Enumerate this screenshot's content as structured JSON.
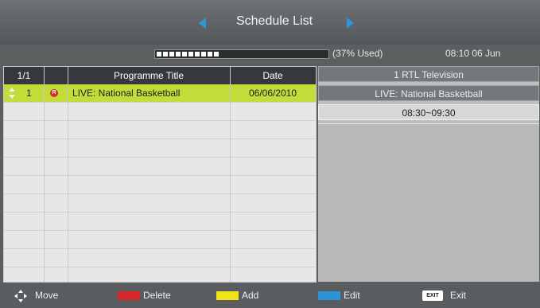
{
  "header": {
    "title": "Schedule List",
    "usage_text": "(37% Used)",
    "usage_fraction": 0.37,
    "clock": "08:10  06 Jun"
  },
  "table": {
    "page": "1/1",
    "columns": [
      "Programme Title",
      "Date"
    ],
    "rows": [
      {
        "index": "1",
        "title": "LIVE: National Basketball",
        "date": "06/06/2010",
        "selected": true
      }
    ]
  },
  "info": {
    "channel": "1 RTL Television",
    "event": "LIVE: National Basketball",
    "time": "08:30~09:30"
  },
  "footer": {
    "move": "Move",
    "delete": "Delete",
    "add": "Add",
    "edit": "Edit",
    "exit_badge": "EXIT",
    "exit": "Exit"
  },
  "colors": {
    "accent_arrow": "#2e97d8",
    "selected_row": "#c3dc3a",
    "key_red": "#d8282a",
    "key_yellow": "#f2e21c",
    "key_blue": "#2b93d6"
  },
  "icons": [
    "arrow-left-icon",
    "arrow-right-icon",
    "record-icon",
    "move-icon",
    "updown-icon"
  ]
}
